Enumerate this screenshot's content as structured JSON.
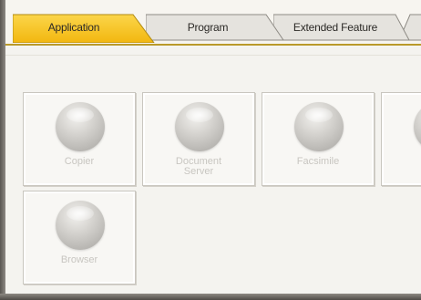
{
  "tabs": [
    {
      "label": "Application",
      "active": true
    },
    {
      "label": "Program",
      "active": false
    },
    {
      "label": "Extended Feature",
      "active": false
    },
    {
      "label": "",
      "active": false
    }
  ],
  "apps": [
    {
      "label": "Copier"
    },
    {
      "label": "Document\nServer"
    },
    {
      "label": "Facsimile"
    },
    {
      "label": ""
    },
    {
      "label": "Browser"
    }
  ],
  "colors": {
    "active_tab": "#f6c21b",
    "inactive_tab": "#e5e3de",
    "panel_bg": "#f4f3ef",
    "tile_text": "#c8c6c1"
  }
}
